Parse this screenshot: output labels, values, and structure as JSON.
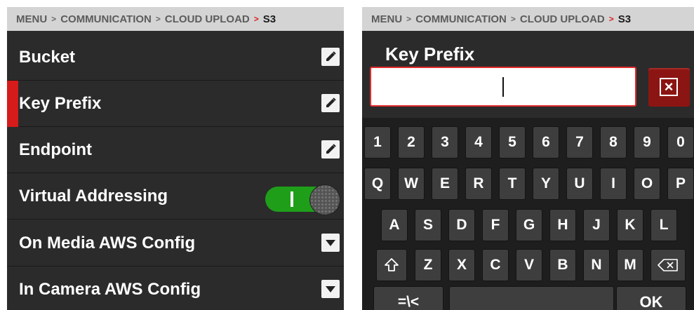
{
  "breadcrumb": {
    "menu": "MENU",
    "communication": "COMMUNICATION",
    "cloud_upload": "CLOUD UPLOAD",
    "current": "S3",
    "separator": ">"
  },
  "settings": {
    "bucket": "Bucket",
    "key_prefix": "Key Prefix",
    "endpoint": "Endpoint",
    "virtual_addressing": "Virtual Addressing",
    "virtual_addressing_on": true,
    "on_media_aws_config": "On Media AWS Config",
    "in_camera_aws_config": "In Camera AWS Config",
    "selected": "Key Prefix"
  },
  "editor": {
    "title": "Key Prefix",
    "value": ""
  },
  "keyboard": {
    "row1": [
      "1",
      "2",
      "3",
      "4",
      "5",
      "6",
      "7",
      "8",
      "9",
      "0"
    ],
    "row2": [
      "Q",
      "W",
      "E",
      "R",
      "T",
      "Y",
      "U",
      "I",
      "O",
      "P"
    ],
    "row3": [
      "A",
      "S",
      "D",
      "F",
      "G",
      "H",
      "J",
      "K",
      "L"
    ],
    "row4": [
      "Z",
      "X",
      "C",
      "V",
      "B",
      "N",
      "M"
    ],
    "symbols_label": "=\\<",
    "ok_label": "OK"
  },
  "icons": [
    "pencil-icon",
    "chevron-down-icon",
    "shift-icon",
    "backspace-icon",
    "clear-icon"
  ],
  "colors": {
    "accent": "#d61b1b",
    "toggle_on": "#1f9e1a",
    "panel": "#2b2b2b",
    "breadcrumb_bg": "#d4d4d4"
  }
}
